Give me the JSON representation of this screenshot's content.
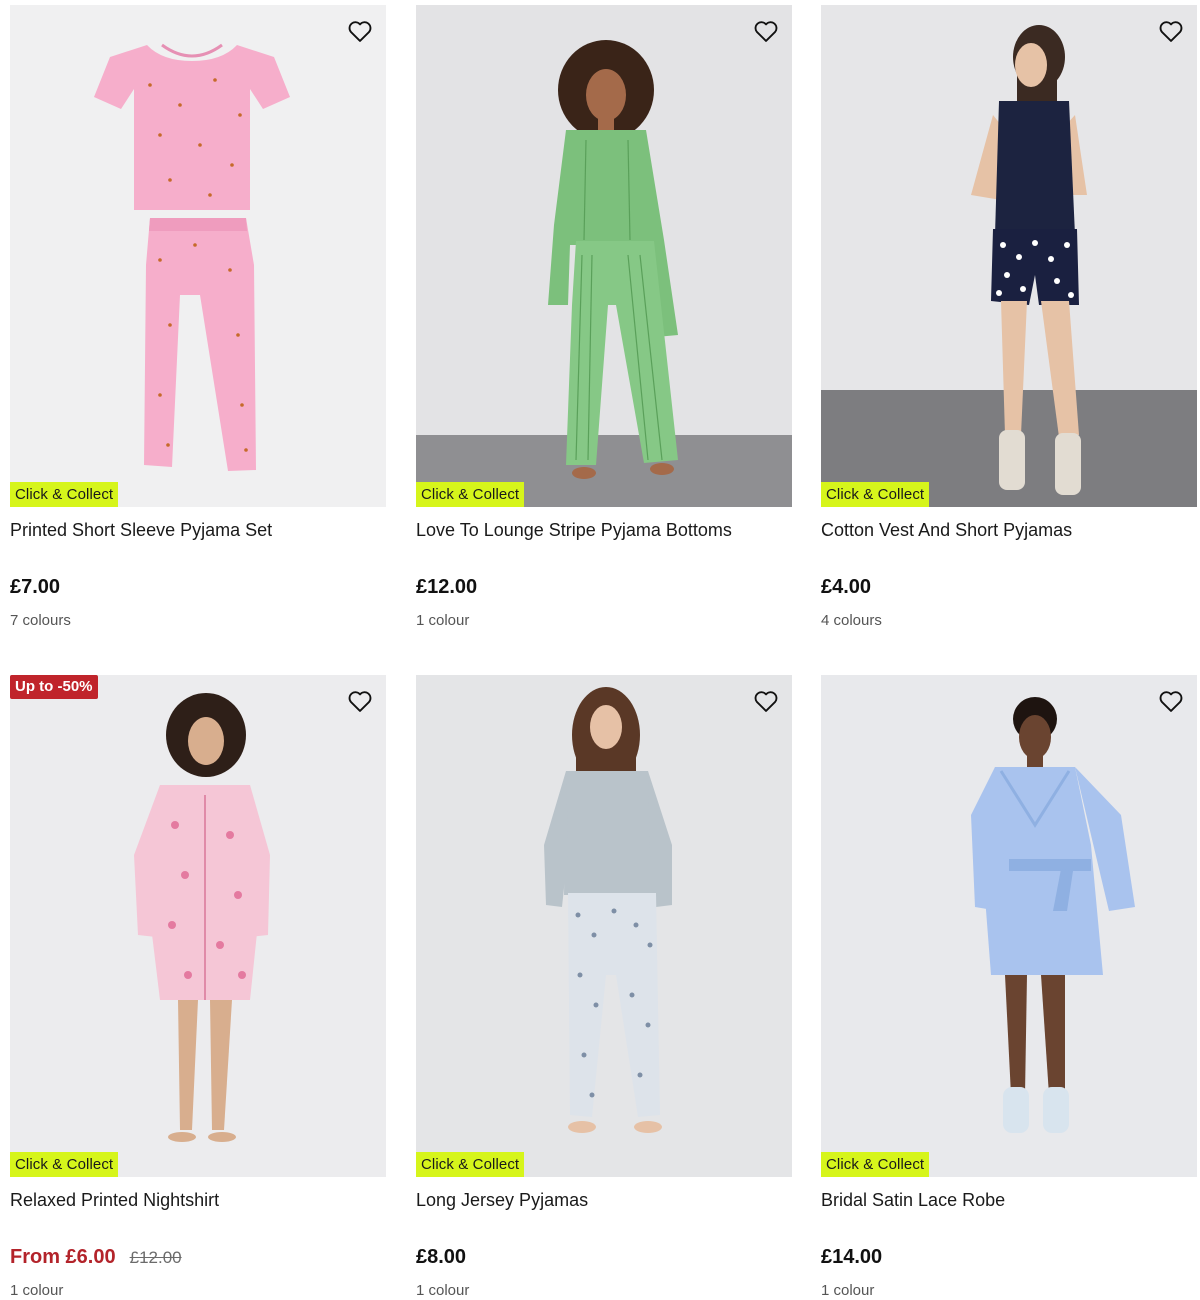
{
  "products": [
    {
      "name": "Printed Short Sleeve Pyjama Set",
      "price": "£7.00",
      "colours": "7 colours",
      "badge_bottom": "Click & Collect",
      "icon": "heart-icon"
    },
    {
      "name": "Love To Lounge Stripe Pyjama Bottoms",
      "price": "£12.00",
      "colours": "1 colour",
      "badge_bottom": "Click & Collect",
      "icon": "heart-icon"
    },
    {
      "name": "Cotton Vest And Short Pyjamas",
      "price": "£4.00",
      "colours": "4 colours",
      "badge_bottom": "Click & Collect",
      "icon": "heart-icon"
    },
    {
      "name": "Relaxed Printed Nightshirt",
      "price": "From £6.00",
      "was_price": "£12.00",
      "colours": "1 colour",
      "badge_top": "Up to -50%",
      "badge_bottom": "Click & Collect",
      "icon": "heart-icon"
    },
    {
      "name": "Long Jersey Pyjamas",
      "price": "£8.00",
      "colours": "1 colour",
      "badge_bottom": "Click & Collect",
      "icon": "heart-icon"
    },
    {
      "name": "Bridal Satin Lace Robe",
      "price": "£14.00",
      "colours": "1 colour",
      "badge_bottom": "Click & Collect",
      "icon": "heart-icon"
    }
  ],
  "colors": {
    "click_collect_badge": "#d6f51b",
    "sale_badge": "#c0242b",
    "sale_price": "#b3232a",
    "image_background": "#efeff0"
  }
}
